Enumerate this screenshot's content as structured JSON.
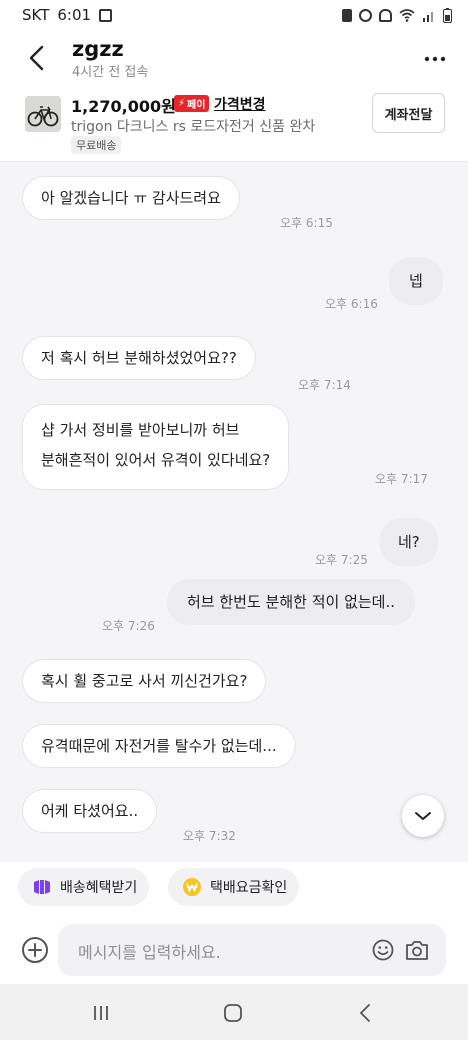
{
  "status_bar": {
    "carrier": "SKT",
    "time": "6:01"
  },
  "header": {
    "title": "zgzz",
    "subtitle": "4시간 전 접속"
  },
  "product": {
    "price": "1,270,000원",
    "pay_badge": "페이",
    "price_change": "가격변경",
    "name": "trigon 다크니스 rs 로드자전거 신품 완차",
    "shipping_tag": "무료배송",
    "transfer_button": "계좌전달"
  },
  "messages": [
    {
      "side": "in",
      "text": "아 알겠습니다 ㅠ 감사드려요",
      "time": "오후 6:15"
    },
    {
      "side": "out",
      "text": "넵",
      "time": "오후 6:16"
    },
    {
      "side": "in",
      "text": "저 혹시 허브 분해하셨었어요??",
      "time": "오후 7:14"
    },
    {
      "side": "in",
      "text_line1": "샵 가서 정비를 받아보니까 허브",
      "text_line2": "분해흔적이 있어서  유격이 있다네요?",
      "time": "오후 7:17"
    },
    {
      "side": "out",
      "text": "네?",
      "time": "오후 7:25"
    },
    {
      "side": "out",
      "text": "허브 한번도 분해한 적이 없는데..",
      "time": "오후 7:26"
    },
    {
      "side": "in",
      "text": "혹시 휠 중고로 사서 끼신건가요?"
    },
    {
      "side": "in",
      "text": "유격때문에 자전거를 탈수가 없는데..."
    },
    {
      "side": "in",
      "text": "어케 타셨어요..",
      "time": "오후 7:32"
    }
  ],
  "chips": {
    "shipping_benefit": "배송혜택받기",
    "delivery_fee": "택배요금확인"
  },
  "input": {
    "placeholder": "메시지를 입력하세요."
  },
  "colors": {
    "pay_badge": "#e5262b",
    "chat_background": "#f5f5f7",
    "chip_purple": "#7b3ff2",
    "chip_yellow": "#f7c325"
  }
}
